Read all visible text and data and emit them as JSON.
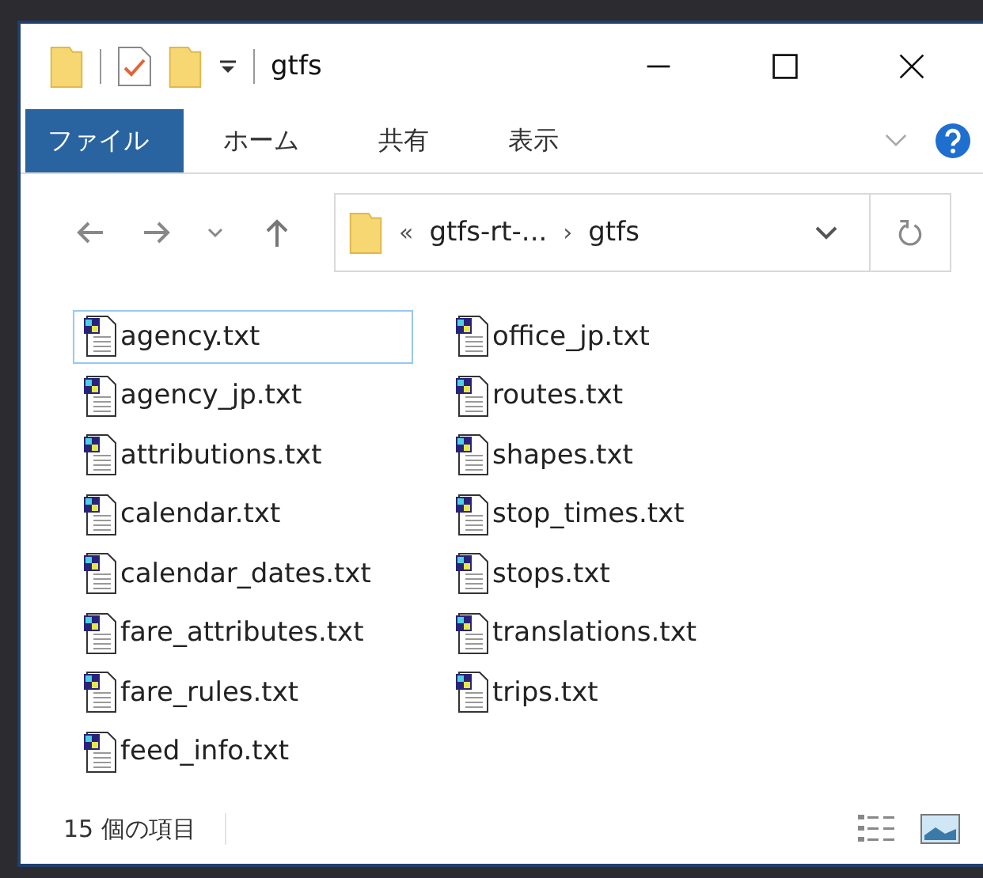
{
  "window": {
    "title": "gtfs"
  },
  "ribbon_tabs": [
    {
      "label": "ファイル",
      "selected": true
    },
    {
      "label": "ホーム",
      "selected": false
    },
    {
      "label": "共有",
      "selected": false
    },
    {
      "label": "表示",
      "selected": false
    }
  ],
  "address_bar": {
    "overflow_mark": "«",
    "segments": [
      "gtfs-rt-...",
      "gtfs"
    ],
    "separator": "›"
  },
  "files": [
    {
      "name": "agency.txt",
      "focused": true
    },
    {
      "name": "agency_jp.txt",
      "focused": false
    },
    {
      "name": "attributions.txt",
      "focused": false
    },
    {
      "name": "calendar.txt",
      "focused": false
    },
    {
      "name": "calendar_dates.txt",
      "focused": false
    },
    {
      "name": "fare_attributes.txt",
      "focused": false
    },
    {
      "name": "fare_rules.txt",
      "focused": false
    },
    {
      "name": "feed_info.txt",
      "focused": false
    },
    {
      "name": "office_jp.txt",
      "focused": false
    },
    {
      "name": "routes.txt",
      "focused": false
    },
    {
      "name": "shapes.txt",
      "focused": false
    },
    {
      "name": "stop_times.txt",
      "focused": false
    },
    {
      "name": "stops.txt",
      "focused": false
    },
    {
      "name": "translations.txt",
      "focused": false
    },
    {
      "name": "trips.txt",
      "focused": false
    }
  ],
  "status_bar": {
    "item_count": "15 個の項目"
  }
}
